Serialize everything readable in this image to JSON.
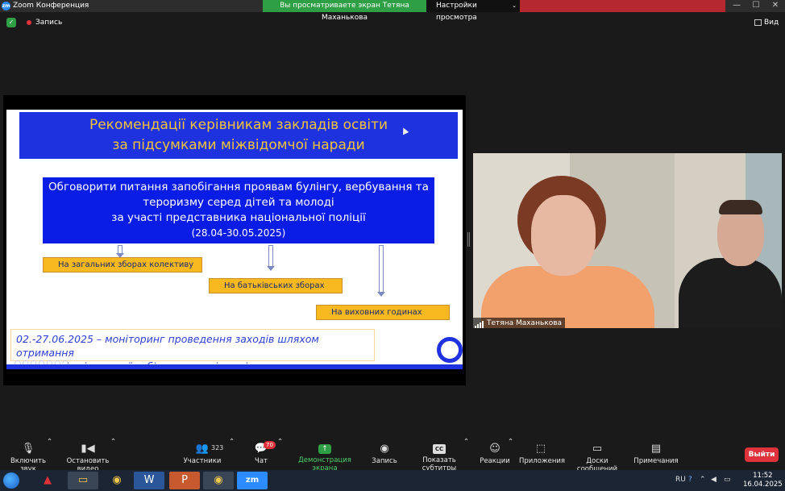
{
  "titlebar": {
    "app_title": "Zoom Конференция",
    "share_banner": "Вы просматриваете экран Тетяна Маханькова",
    "view_settings": "Настройки просмотра",
    "minimize": "—",
    "maximize": "☐",
    "close": "✕"
  },
  "meeting": {
    "record_label": "Запись",
    "view_label": "Вид"
  },
  "slide": {
    "title_line1": "Рекомендації керівникам закладів освіти",
    "title_line2": "за підсумками міжвідомчої наради",
    "main_line1": "Обговорити питання запобігання проявам булінгу, вербування та",
    "main_line2": "тероризму серед дітей та молоді",
    "main_line3": "за участі представника національної поліції",
    "main_date": "(28.04-30.05.2025)",
    "box1": "На загальних зборах колективу",
    "box2": "На батьківських зборах",
    "box3": "На виховних годинах",
    "monitor_line1": "02.-27.06.2025 – моніторинг проведення заходів шляхом отримання",
    "monitor_line2": "протоколів від певної вибірки закладів освіти"
  },
  "video": {
    "participant_name": "Тетяна Маханькова"
  },
  "toolbar": {
    "audio": "Включить звук",
    "video": "Остановить видео",
    "participants": "Участники",
    "participants_count": "323",
    "chat": "Чат",
    "chat_badge": "70",
    "share": "Демонстрация экрана",
    "record": "Запись",
    "subtitles": "Показать субтитры",
    "reactions": "Реакции",
    "apps": "Приложения",
    "whiteboards": "Доски сообщений",
    "notes": "Примечания",
    "leave": "Выйти"
  },
  "taskbar": {
    "language": "RU",
    "time": "11:52",
    "date": "16.04.2025"
  },
  "colors": {
    "slide_blue": "#1e32e0",
    "slide_gold": "#f6c338",
    "orange_box": "#f7b820",
    "share_green": "#2e9f44",
    "leave_red": "#e0323b"
  }
}
